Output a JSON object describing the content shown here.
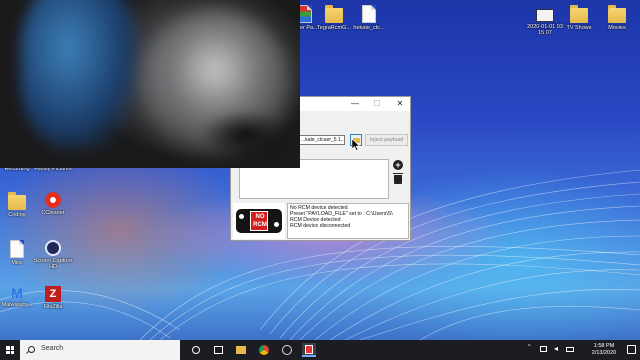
{
  "desktop": {
    "icons": [
      {
        "id": "top1",
        "label": "...her Pa..."
      },
      {
        "id": "top2",
        "label": "TegraRcmG..."
      },
      {
        "id": "top3",
        "label": "hekate_ctc..."
      },
      {
        "id": "date",
        "label": "2020-01-01 03 15 07"
      },
      {
        "id": "shows",
        "label": "TV Shows"
      },
      {
        "id": "movies",
        "label": "Movies"
      },
      {
        "id": "recording",
        "label": "Recording"
      },
      {
        "id": "family",
        "label": "Family Pictures"
      },
      {
        "id": "coding",
        "label": "Coding"
      },
      {
        "id": "ccleaner",
        "label": "CCleaner"
      },
      {
        "id": "misc",
        "label": "Misc"
      },
      {
        "id": "capture",
        "label": "Screen Capture HD"
      },
      {
        "id": "malwarebytes",
        "label": "Malwareby..."
      },
      {
        "id": "filezilla",
        "label": "FileZilla"
      }
    ]
  },
  "tegra_window": {
    "controls": {
      "minimize": "—",
      "maximize": "☐",
      "close": "✕"
    },
    "payload_path": "...kate_ctcaer_5.1...",
    "inject_label": "Inject payload",
    "status_image_text": [
      "NO",
      "RCM"
    ],
    "log_lines": [
      "No RCM device detected",
      "Preset \"PAYLOAD_FILE\" set to : C:\\Users\\S\\",
      "RCM Device detected",
      "RCM device disconnected"
    ]
  },
  "taskbar": {
    "search_placeholder": "Search",
    "time": "1:58 PM",
    "date": "2/13/2020"
  }
}
